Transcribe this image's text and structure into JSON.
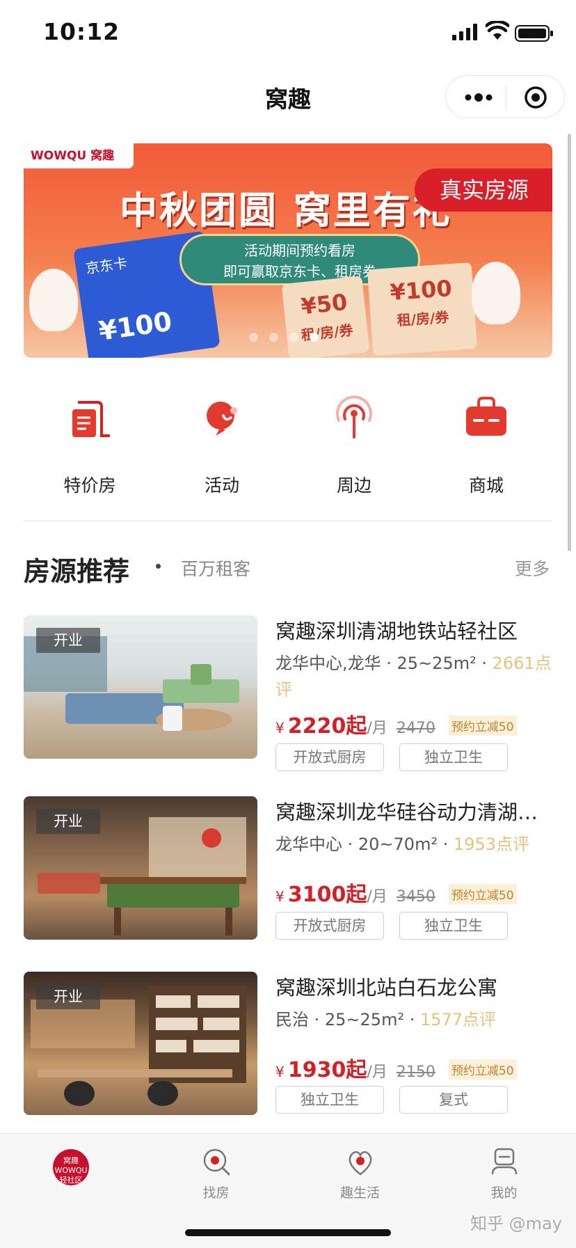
{
  "status_bar": {
    "time": "10:12"
  },
  "nav": {
    "title": "窝趣"
  },
  "banner": {
    "logo_text": "WOWQU 窝趣",
    "headline": "中秋团圆 窝里有礼",
    "tag": "真实房源",
    "pill_line1": "活动期间预约看房",
    "pill_line2": "即可赢取京东卡、租房券",
    "jd_label": "京东卡",
    "jd_amount": "¥100",
    "coupon_50_amount": "¥50",
    "coupon_50_label": "租/房/券",
    "coupon_100_amount": "¥100",
    "coupon_100_label": "租/房/券",
    "slide_count": 4,
    "active_slide": 3
  },
  "categories": [
    {
      "label": "特价房",
      "icon": "discount-house-icon"
    },
    {
      "label": "活动",
      "icon": "activity-icon"
    },
    {
      "label": "周边",
      "icon": "nearby-icon"
    },
    {
      "label": "商城",
      "icon": "shop-icon"
    }
  ],
  "section": {
    "title": "房源推荐",
    "subtitle": "百万租客",
    "more": "更多"
  },
  "listings": [
    {
      "badge": "开业",
      "title": "窝趣深圳清湖地铁站轻社区",
      "location": "龙华中心,龙华",
      "area": "25~25m²",
      "reviews": "2661点评",
      "price": "2220起",
      "unit": "/月",
      "original_price": "2470",
      "promo": "预约立减50",
      "tags": [
        "开放式厨房",
        "独立卫生"
      ]
    },
    {
      "badge": "开业",
      "title": "窝趣深圳龙华硅谷动力清湖…",
      "location": "龙华中心",
      "area": "20~70m²",
      "reviews": "1953点评",
      "price": "3100起",
      "unit": "/月",
      "original_price": "3450",
      "promo": "预约立减50",
      "tags": [
        "开放式厨房",
        "独立卫生"
      ]
    },
    {
      "badge": "开业",
      "title": "窝趣深圳北站白石龙公寓",
      "location": "民治",
      "area": "25~25m²",
      "reviews": "1577点评",
      "price": "1930起",
      "unit": "/月",
      "original_price": "2150",
      "promo": "预约立减50",
      "tags": [
        "独立卫生",
        "复式"
      ]
    }
  ],
  "tabbar": {
    "home_logo": "窝趣 WOWQU 轻社区",
    "tabs": [
      {
        "label": "找房",
        "icon": "find-house-icon"
      },
      {
        "label": "趣生活",
        "icon": "fun-life-icon"
      },
      {
        "label": "我的",
        "icon": "profile-icon"
      }
    ]
  },
  "watermark": "知乎 @may",
  "colors": {
    "brand_red": "#d31f26",
    "review_gold": "#e9c27a",
    "promo_bg": "#fcf0d9"
  }
}
